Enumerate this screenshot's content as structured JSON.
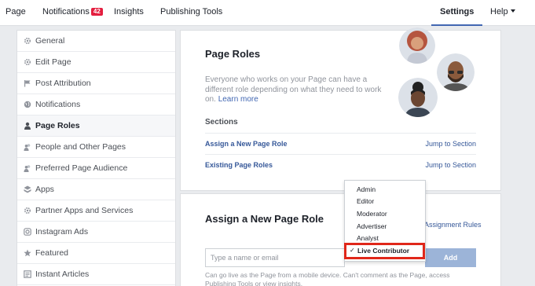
{
  "topnav": {
    "page": "Page",
    "notifications": "Notifications",
    "notifications_count": "42",
    "insights": "Insights",
    "publishing_tools": "Publishing Tools",
    "settings": "Settings",
    "help": "Help"
  },
  "sidebar": {
    "items": [
      {
        "label": "General",
        "icon": "gear-icon"
      },
      {
        "label": "Edit Page",
        "icon": "gear-icon"
      },
      {
        "label": "Post Attribution",
        "icon": "flag-icon"
      },
      {
        "label": "Notifications",
        "icon": "globe-icon"
      },
      {
        "label": "Page Roles",
        "icon": "person-icon",
        "active": true
      },
      {
        "label": "People and Other Pages",
        "icon": "people-icon"
      },
      {
        "label": "Preferred Page Audience",
        "icon": "people-icon"
      },
      {
        "label": "Apps",
        "icon": "apps-icon"
      },
      {
        "label": "Partner Apps and Services",
        "icon": "gear-icon"
      },
      {
        "label": "Instagram Ads",
        "icon": "instagram-icon"
      },
      {
        "label": "Featured",
        "icon": "star-icon"
      },
      {
        "label": "Instant Articles",
        "icon": "article-icon"
      }
    ]
  },
  "page_roles": {
    "title": "Page Roles",
    "description": "Everyone who works on your Page can have a different role depending on what they need to work on.",
    "learn_more": "Learn more",
    "sections_label": "Sections",
    "sections": [
      {
        "name": "Assign a New Page Role",
        "jump": "Jump to Section"
      },
      {
        "name": "Existing Page Roles",
        "jump": "Jump to Section"
      }
    ]
  },
  "assign": {
    "title": "Assign a New Page Role",
    "rules_link": "Assignment Rules",
    "input_placeholder": "Type a name or email",
    "add_button": "Add",
    "note": "Can go live as the Page from a mobile device. Can't comment as the Page, access Publishing Tools or view insights."
  },
  "role_dropdown": {
    "options": [
      "Admin",
      "Editor",
      "Moderator",
      "Advertiser",
      "Analyst"
    ],
    "selected": "Live Contributor",
    "highlight_color": "#e0271a"
  },
  "colors": {
    "accent": "#4267b2",
    "link": "#365899",
    "badge": "#e41e3f",
    "add_button": "#9cb4d8"
  }
}
